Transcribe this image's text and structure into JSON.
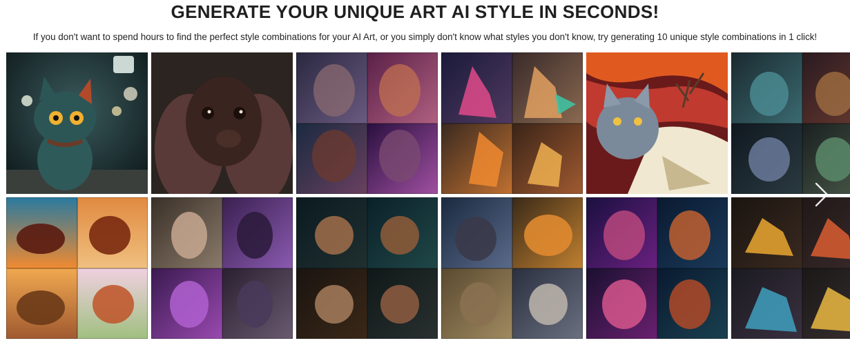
{
  "header": {
    "title": "GENERATE YOUR UNIQUE ART AI STYLE IN SECONDS!",
    "subtitle": "If you don't want to spend hours to find the perfect style combinations for your AI Art, or you simply don't know what styles you don't know, try generating 10 unique style combinations in 1 click!"
  },
  "gallery": {
    "next_icon": "chevron-right-icon"
  }
}
